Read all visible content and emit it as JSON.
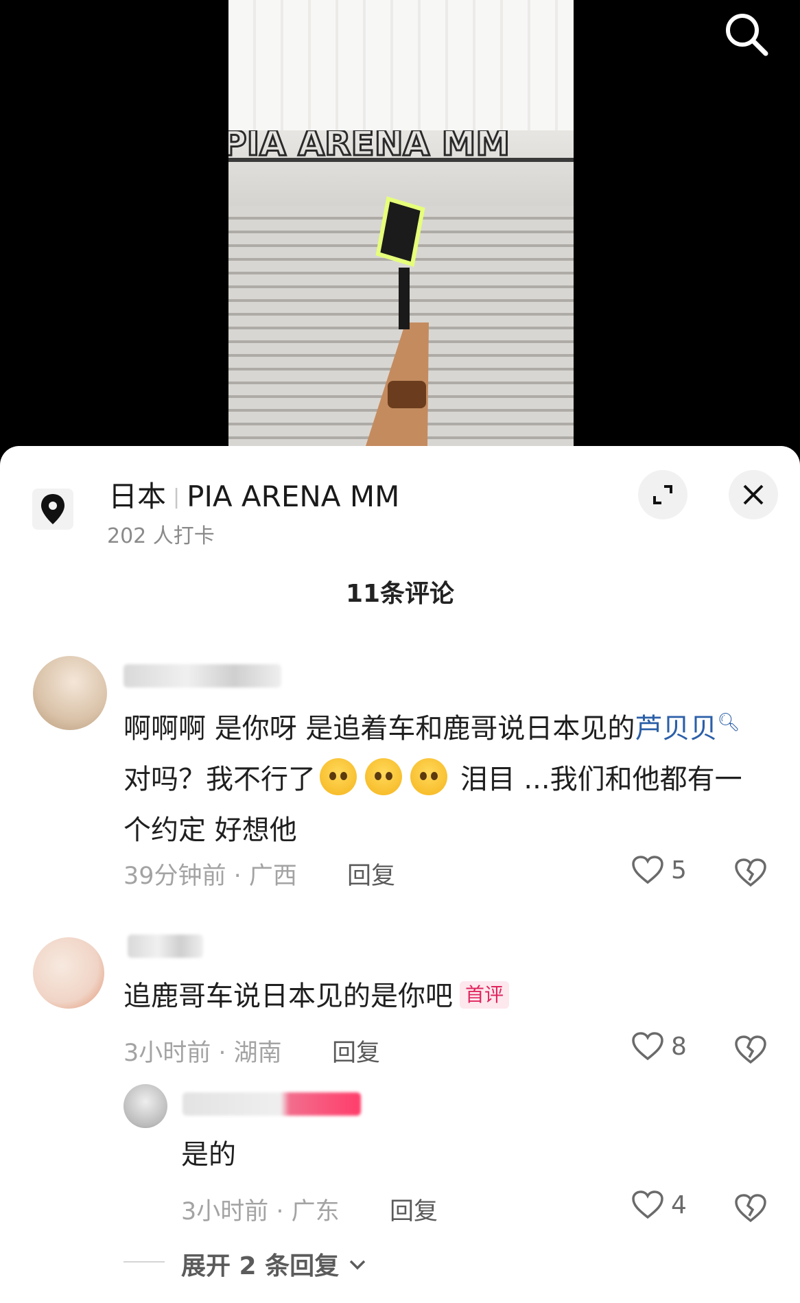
{
  "video": {
    "sign_text": "PIA ARENA MM"
  },
  "location": {
    "country": "日本",
    "venue": "PIA ARENA MM",
    "checkins": "202 人打卡"
  },
  "comments_header": "11条评论",
  "comments": [
    {
      "text_a": "啊啊啊 是你呀 是追着车和鹿哥说日本见的",
      "mention": "芦贝贝",
      "text_b": " 对吗？我不行了",
      "text_c": " 泪目 ...我们和他都有一个约定 好想他",
      "time_loc": "39分钟前 · 广西",
      "reply": "回复",
      "likes": "5"
    },
    {
      "text": "追鹿哥车说日本见的是你吧",
      "badge": "首评",
      "time_loc": "3小时前 · 湖南",
      "reply": "回复",
      "likes": "8"
    },
    {
      "text": "是的",
      "time_loc": "3小时前 · 广东",
      "reply": "回复",
      "likes": "4"
    }
  ],
  "expand_replies": "展开 2 条回复",
  "icons": [
    "search-icon",
    "location-pin-icon",
    "expand-icon",
    "close-icon",
    "heart-icon",
    "broken-heart-icon",
    "chevron-down-icon"
  ]
}
